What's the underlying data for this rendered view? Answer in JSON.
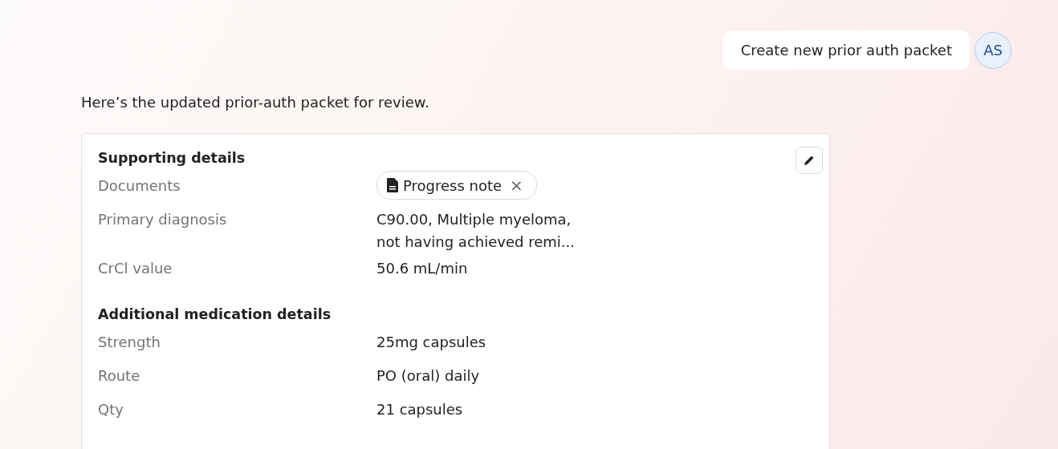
{
  "user_message": {
    "text": "Create new prior auth packet",
    "avatar": "AS"
  },
  "assistant_message": {
    "text": "Here’s the updated prior-auth packet for review."
  },
  "packet": {
    "sections": [
      {
        "title": "Supporting details",
        "rows": [
          {
            "label": "Documents",
            "kind": "document",
            "value": "Progress note",
            "remove": "×"
          },
          {
            "label": "Primary diagnosis",
            "kind": "text",
            "lines": [
              "C90.00, Multiple myeloma,",
              "not having achieved remi..."
            ]
          },
          {
            "label": "CrCl value",
            "kind": "text",
            "lines": [
              "50.6 mL/min"
            ]
          }
        ]
      },
      {
        "title": "Additional medication details",
        "rows": [
          {
            "label": "Strength",
            "kind": "text",
            "lines": [
              "25mg capsules"
            ]
          },
          {
            "label": "Route",
            "kind": "text",
            "lines": [
              "PO (oral) daily"
            ]
          },
          {
            "label": "Qty",
            "kind": "text",
            "lines": [
              "21 capsules"
            ]
          }
        ]
      }
    ]
  }
}
